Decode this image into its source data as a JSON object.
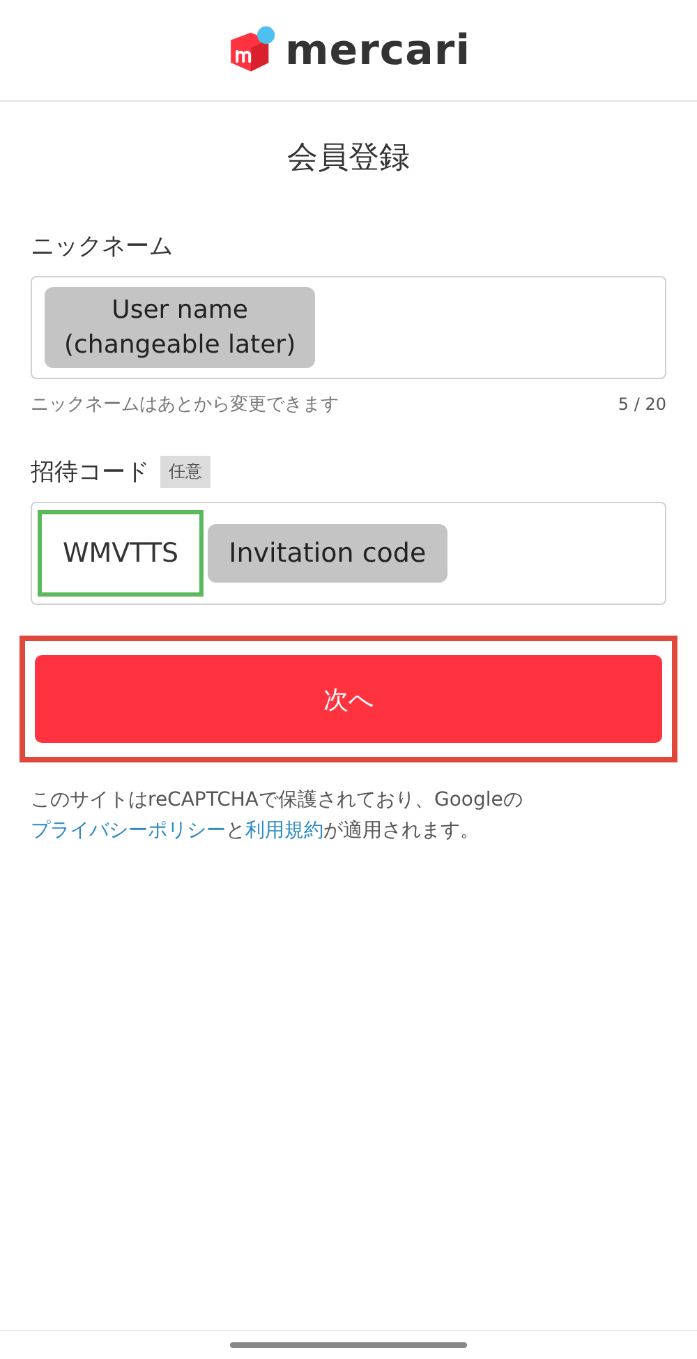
{
  "header": {
    "logo_text": "mercari"
  },
  "title": "会員登録",
  "nickname": {
    "label": "ニックネーム",
    "annotation": "User name\n(changeable later)",
    "hint": "ニックネームはあとから変更できます",
    "counter": "5 / 20"
  },
  "invitation": {
    "label": "招待コード",
    "badge": "任意",
    "value": "WMVTTS",
    "highlighted": true,
    "annotation": "Invitation code"
  },
  "submit": {
    "label": "次へ",
    "highlighted": true
  },
  "notice": [
    {
      "kind": "text",
      "text": "このサイトはreCAPTCHAで保護されており、Googleの"
    },
    {
      "kind": "link",
      "text": "プライバシーポリシー"
    },
    {
      "kind": "text",
      "text": "と"
    },
    {
      "kind": "link",
      "text": "利用規約"
    },
    {
      "kind": "text",
      "text": "が適用されます。"
    }
  ]
}
